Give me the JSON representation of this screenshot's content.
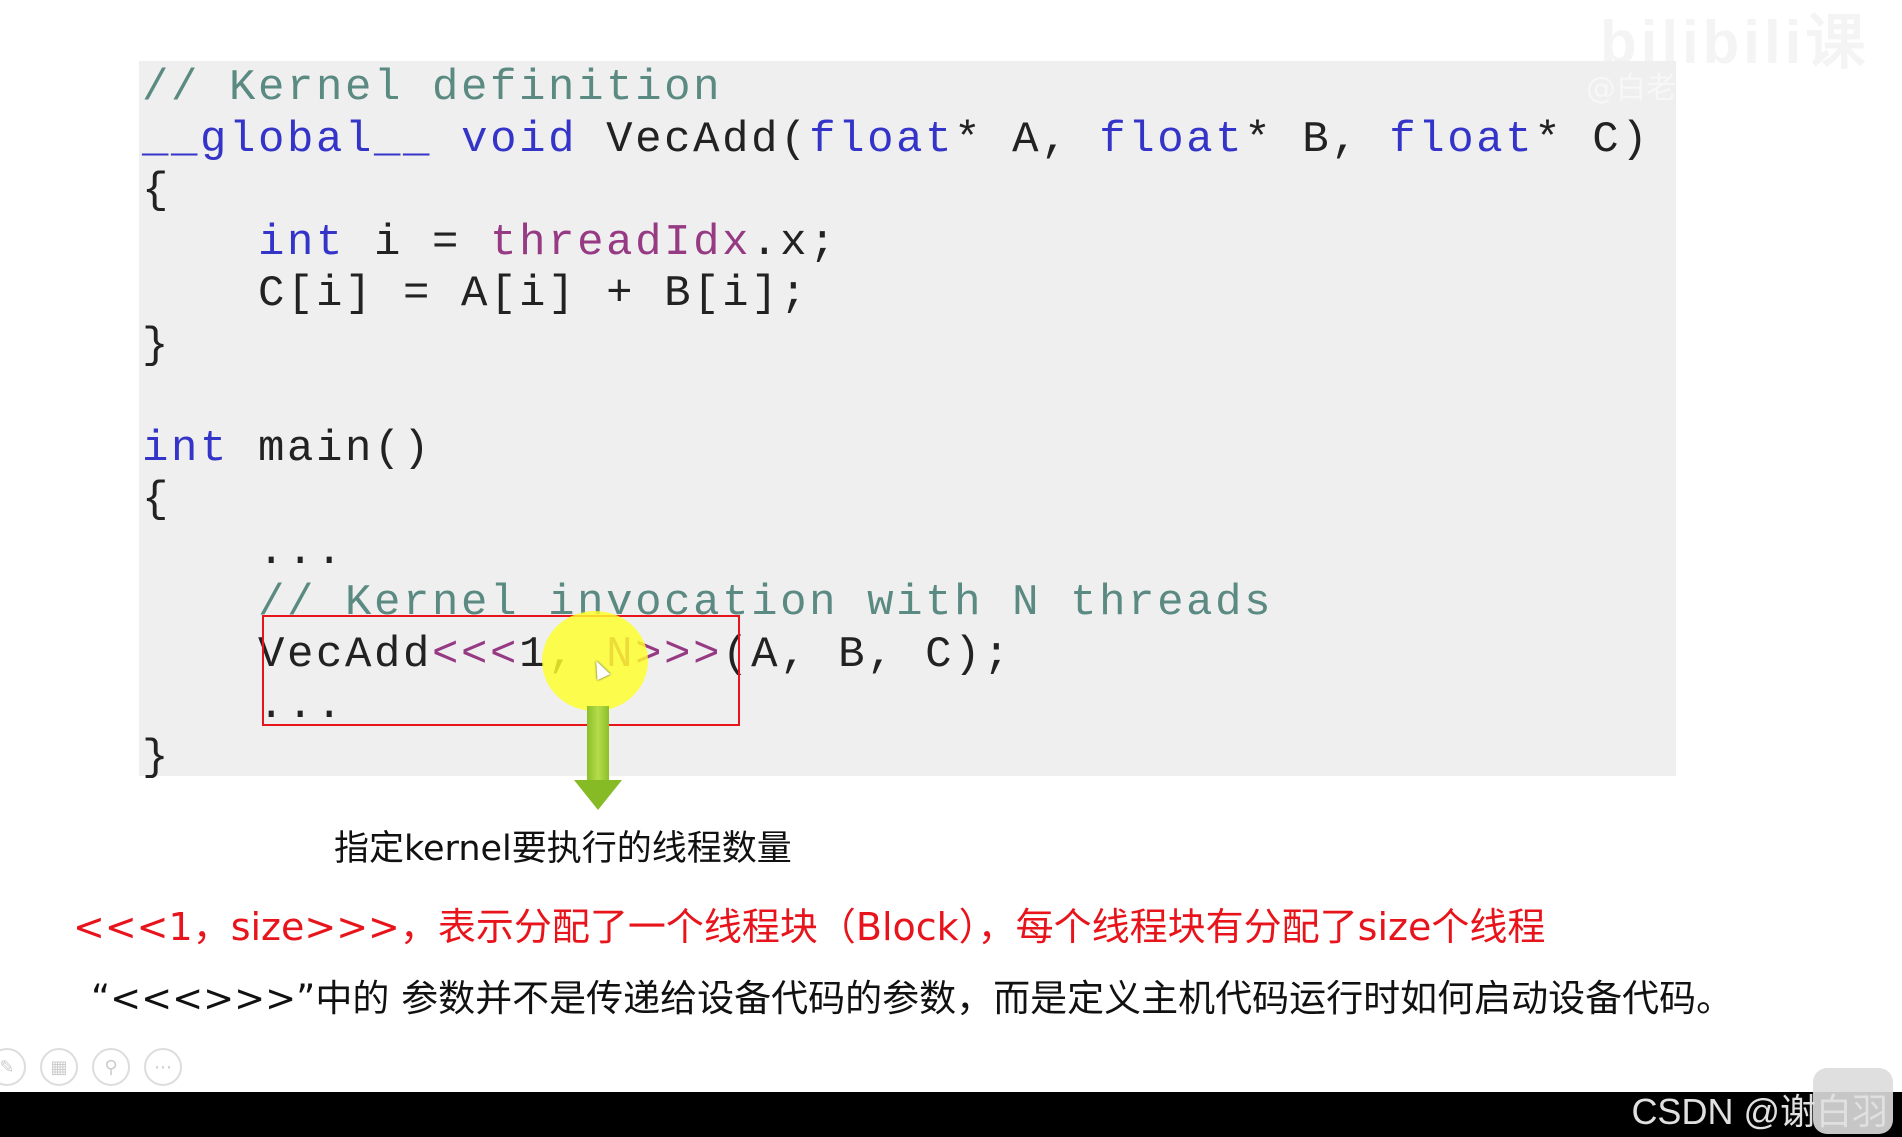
{
  "watermark": {
    "logo": "bilibili课堂",
    "user": "@白老"
  },
  "code_lines": [
    [
      [
        "c",
        "// Kernel definition"
      ]
    ],
    [
      [
        "k",
        "__global__"
      ],
      [
        "n",
        " "
      ],
      [
        "k",
        "void"
      ],
      [
        "n",
        " VecAdd("
      ],
      [
        "k",
        "float"
      ],
      [
        "n",
        "* A, "
      ],
      [
        "k",
        "float"
      ],
      [
        "n",
        "* B, "
      ],
      [
        "k",
        "float"
      ],
      [
        "n",
        "* C)"
      ]
    ],
    [
      [
        "n",
        "{"
      ]
    ],
    [
      [
        "n",
        "    "
      ],
      [
        "k",
        "int"
      ],
      [
        "n",
        " i = "
      ],
      [
        "p",
        "threadIdx"
      ],
      [
        "n",
        ".x;"
      ]
    ],
    [
      [
        "n",
        "    C[i] = A[i] + B[i];"
      ]
    ],
    [
      [
        "n",
        "}"
      ]
    ],
    [
      [
        "n",
        " "
      ]
    ],
    [
      [
        "k",
        "int"
      ],
      [
        "n",
        " main()"
      ]
    ],
    [
      [
        "n",
        "{"
      ]
    ],
    [
      [
        "n",
        "    ..."
      ]
    ],
    [
      [
        "n",
        "    "
      ],
      [
        "c",
        "// Kernel invocation with N threads"
      ]
    ],
    [
      [
        "n",
        "    VecAdd"
      ],
      [
        "p",
        "<<<"
      ],
      [
        "n",
        "1, "
      ],
      [
        "p",
        "N>>>"
      ],
      [
        "n",
        "(A, B, C);"
      ]
    ],
    [
      [
        "n",
        "    ..."
      ]
    ],
    [
      [
        "n",
        "}"
      ]
    ]
  ],
  "annotation": {
    "caption": "指定kernel要执行的线程数量"
  },
  "notes": {
    "red": "<<<1，size>>>，表示分配了一个线程块（Block），每个线程块有分配了size个线程",
    "black": "“<<<>>>”中的 参数并不是传递给设备代码的参数，而是定义主机代码运行时如何启动设备代码。"
  },
  "toolbar": {
    "icons": [
      "pen-icon",
      "grid-icon",
      "magnifier-icon",
      "more-icon"
    ],
    "glyphs": [
      "✎",
      "▦",
      "⚲",
      "⋯"
    ]
  },
  "footer": {
    "credit": "CSDN @谢白羽"
  },
  "colors": {
    "highlight_box": "#e8141c",
    "arrow": "#8cbf2a",
    "spotlight": "#ffff28"
  }
}
